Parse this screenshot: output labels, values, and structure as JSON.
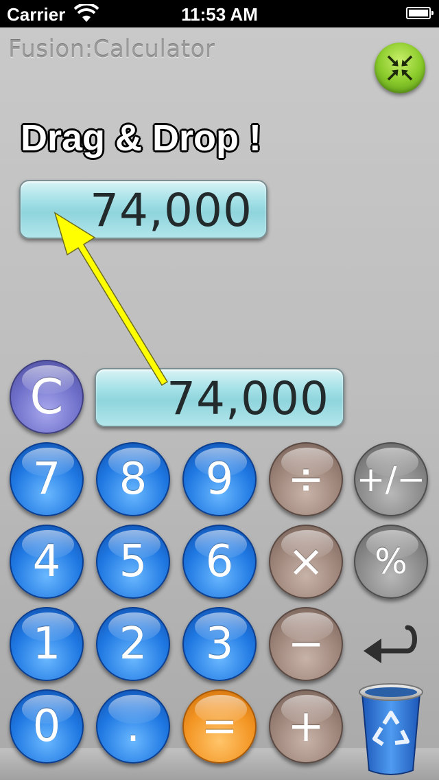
{
  "status_bar": {
    "carrier": "Carrier",
    "time": "11:53 AM"
  },
  "app": {
    "title": "Fusion:Calculator"
  },
  "hint": "Drag & Drop !",
  "displays": {
    "dragged_value": "74,000",
    "main_value": "74,000"
  },
  "keys": {
    "clear": "C",
    "seven": "7",
    "eight": "8",
    "nine": "9",
    "divide": "÷",
    "plus_minus": "+/−",
    "four": "4",
    "five": "5",
    "six": "6",
    "multiply": "×",
    "percent": "%",
    "one": "1",
    "two": "2",
    "three": "3",
    "minus": "−",
    "zero": "0",
    "decimal": ".",
    "equals": "=",
    "plus": "+"
  },
  "icons": [
    "collapse-icon",
    "wifi-icon",
    "battery-icon",
    "enter-icon",
    "trash-icon",
    "recycle-icon"
  ],
  "colors": {
    "digit_blue": "#1f78e2",
    "operator_brown": "#9d8479",
    "equals_orange": "#f39523",
    "display_cyan": "#a4e1e7",
    "arrow_yellow": "#ffff00"
  }
}
